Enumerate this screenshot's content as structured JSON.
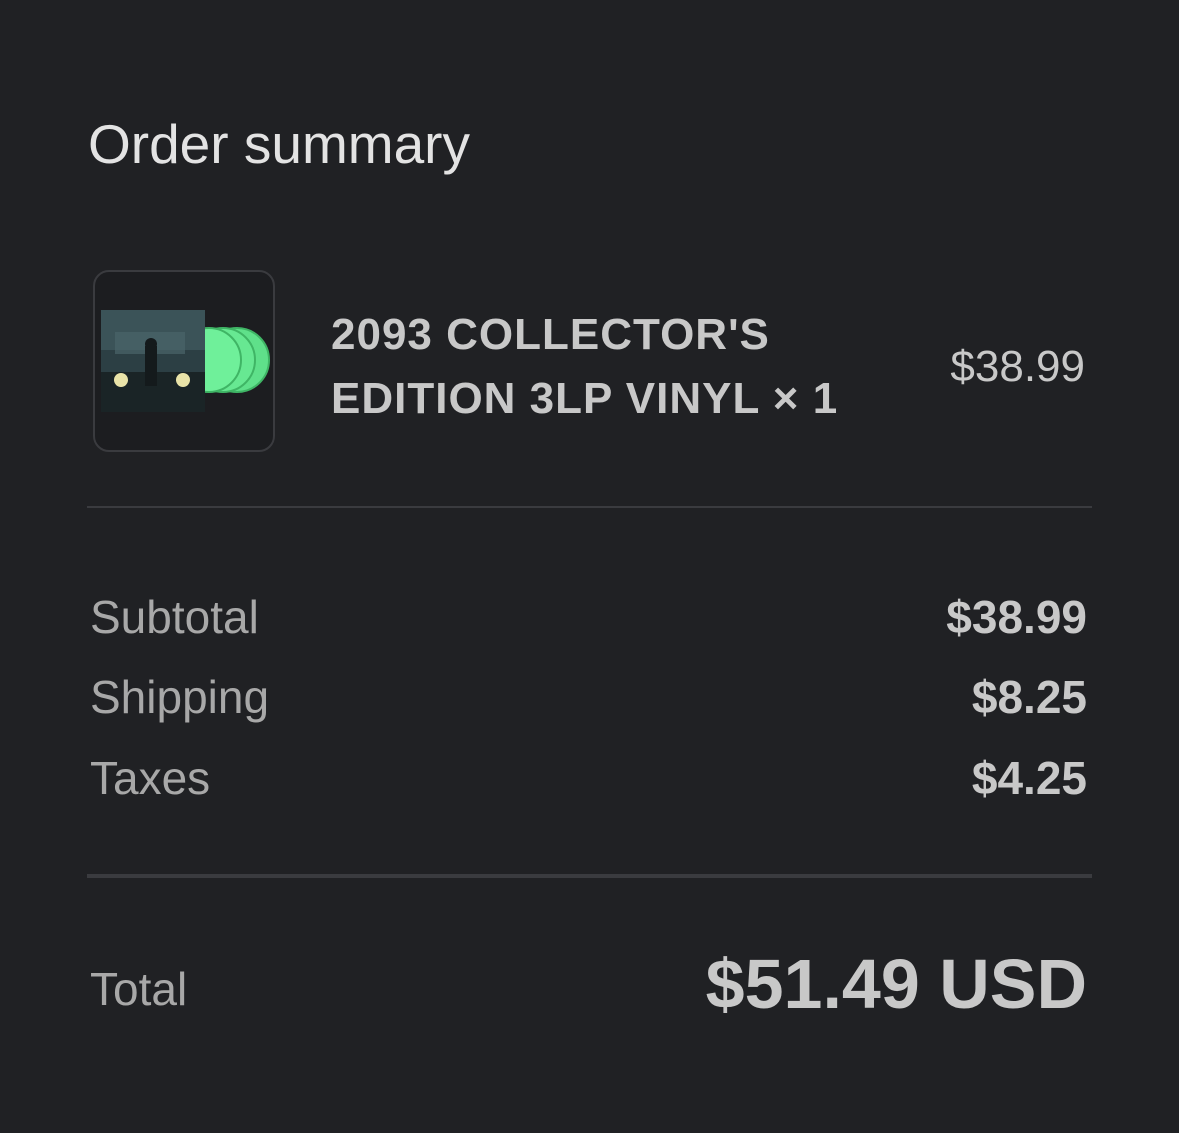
{
  "summary": {
    "heading": "Order summary"
  },
  "item": {
    "title": "2093 COLLECTOR'S EDITION 3LP VINYL × 1",
    "price": "$38.99",
    "thumbnail_icon": "album-vinyl-icon",
    "vinyl_color": "#5fe08a"
  },
  "lines": [
    {
      "label": "Subtotal",
      "value": "$38.99"
    },
    {
      "label": "Shipping",
      "value": "$8.25"
    },
    {
      "label": "Taxes",
      "value": "$4.25"
    }
  ],
  "total": {
    "label": "Total",
    "value": "$51.49 USD"
  }
}
